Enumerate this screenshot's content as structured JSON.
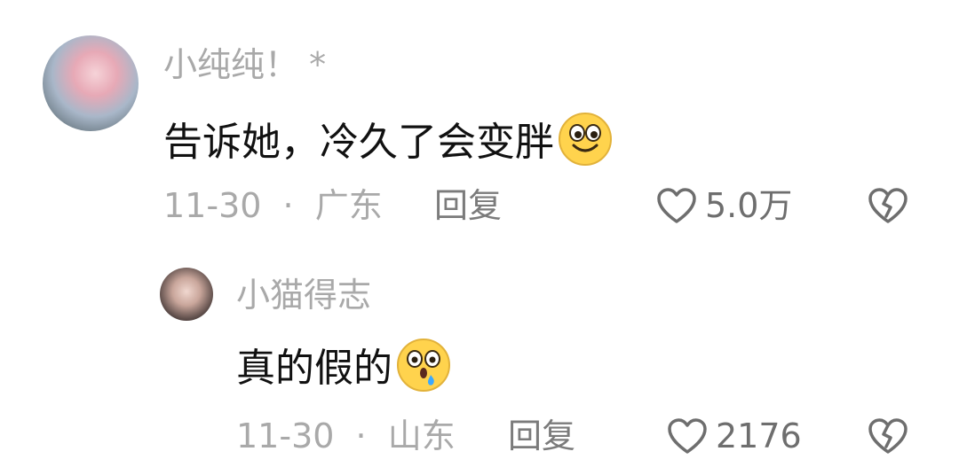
{
  "comments": [
    {
      "username": "小纯纯！ *",
      "content": "告诉她，冷久了会变胖",
      "emoji": "smiling-face-with-big-eyes",
      "date": "11-30",
      "separator": "·",
      "location": "广东",
      "reply_label": "回复",
      "like_count": "5.0万"
    },
    {
      "username": "小猫得志",
      "content": "真的假的",
      "emoji": "surprised-face-with-drop",
      "date": "11-30",
      "separator": "·",
      "location": "山东",
      "reply_label": "回复",
      "like_count": "2176"
    }
  ],
  "icons": {
    "like": "heart-outline-icon",
    "dislike": "broken-heart-icon"
  },
  "colors": {
    "username": "#a9a9a9",
    "content": "#111111",
    "meta": "#a9a9a9",
    "reply": "#7b7b7b",
    "icon": "#6e6e6e",
    "emoji_yellow": "#ffd34d"
  }
}
